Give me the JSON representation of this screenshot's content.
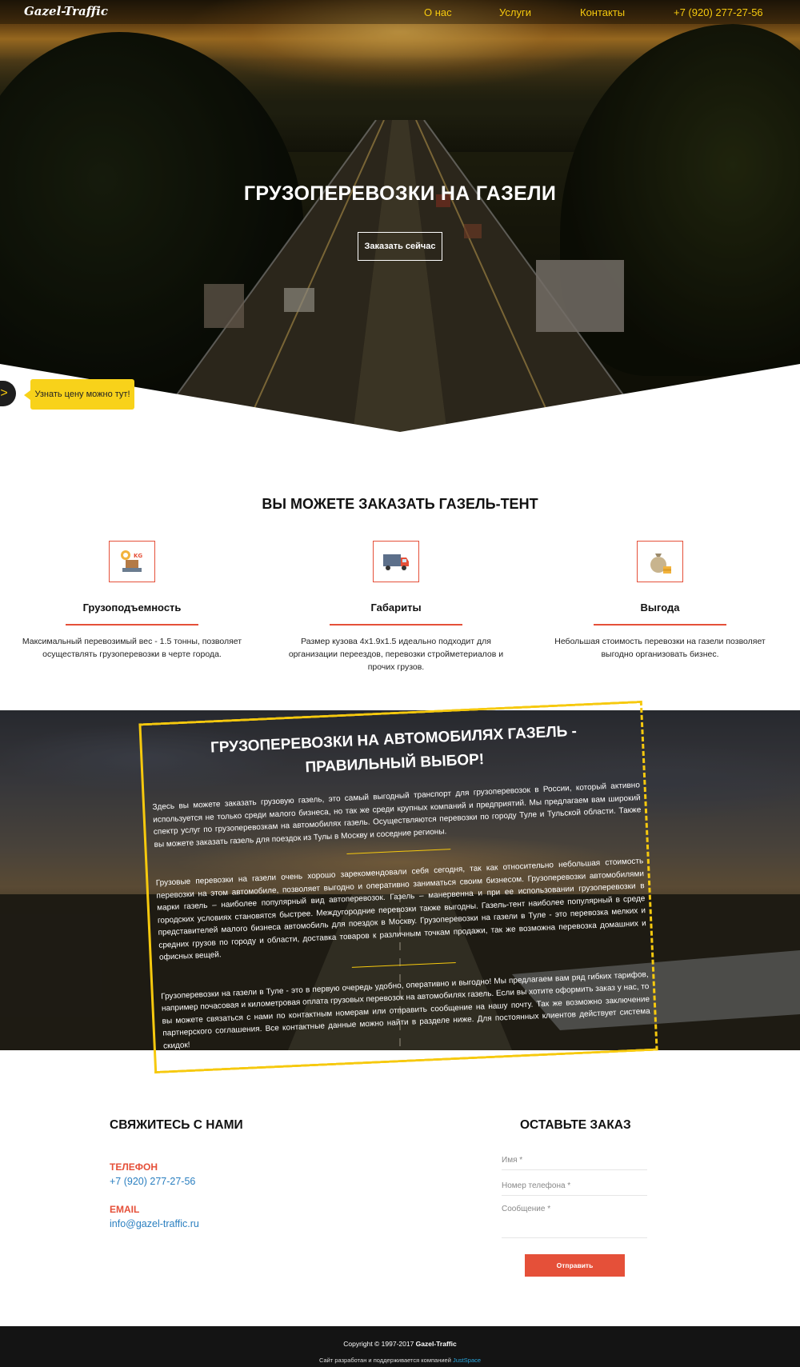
{
  "nav": {
    "logo": "Gazel-Traffic",
    "items": [
      "О нас",
      "Услуги",
      "Контакты"
    ],
    "phone": "+7 (920) 277-27-56"
  },
  "hero": {
    "title": "ГРУЗОПЕРЕВОЗКИ НА ГАЗЕЛИ",
    "button": "Заказать сейчас",
    "price_tip": "Узнать цену можно тут!",
    "arrow_icon": ">"
  },
  "features": {
    "title": "ВЫ МОЖЕТЕ ЗАКАЗАТЬ ГАЗЕЛЬ-ТЕНТ",
    "items": [
      {
        "icon": "scale-weight-icon",
        "name": "Грузоподъемность",
        "text": "Максимальный перевозимый вес - 1.5 тонны, позволяет осуществлять грузоперевозки в черте города."
      },
      {
        "icon": "truck-icon",
        "name": "Габариты",
        "text": "Размер кузова 4х1.9х1.5 идеально подходит для организации переездов, перевозки стройметериалов и прочих грузов."
      },
      {
        "icon": "money-bag-icon",
        "name": "Выгода",
        "text": "Небольшая стоимость перевозки на газели позволяет выгодно организовать бизнес."
      }
    ]
  },
  "about": {
    "title": "ГРУЗОПЕРЕВОЗКИ НА АВТОМОБИЛЯХ ГАЗЕЛЬ - ПРАВИЛЬНЫЙ ВЫБОР!",
    "p1": "Здесь вы можете заказать грузовую газель, это самый выгодный транспорт для грузоперевозок в России, который активно используется не только среди малого бизнеса, но так же среди крупных компаний и предприятий. Мы предлагаем вам широкий спектр услуг по грузоперевозкам на автомобилях газель. Осуществляются перевозки по городу Туле и Тульской области. Также вы можете заказать газель для поездок из Тулы в Москву и соседние регионы.",
    "p2": "Грузовые перевозки на газели очень хорошо зарекомендовали себя сегодня, так как относительно небольшая стоимость перевозки на этом автомобиле, позволяет выгодно и оперативно заниматься своим бизнесом. Грузоперевозки автомобилями марки газель – наиболее популярный вид автоперевозок. Газель – манервенна и при ее использовании грузоперевозки в городских условиях становятся быстрее. Междугородние перевозки также выгодны. Газель-тент наиболее популярный в среде представителей малого бизнеса автомобиль для поездок в Москву. Грузоперевозки на газели в Туле - это перевозка мелких и средних грузов по городу и области, доставка товаров к различным точкам продажи, так же возможна перевозка домашних и офисных вещей.",
    "p3": "Грузоперевозки на газели в Туле - это в первую очередь удобно, оперативно и выгодно! Мы предлагаем вам ряд гибких тарифов, например почасовая и километровая оплата грузовых перевозок на автомобилях газель. Если вы хотите оформить заказ у нас, то вы можете связаться с нами по контактным номерам или отправить сообщение на нашу почту. Так же возможно заключение партнерского соглашения. Все контактные данные можно найти в разделе ниже. Для постоянных клиентов действует система скидок!"
  },
  "contacts": {
    "title": "СВЯЖИТЕСЬ С НАМИ",
    "phone_label": "ТЕЛЕФОН",
    "phone": "+7 (920) 277-27-56",
    "email_label": "EMAIL",
    "email": "info@gazel-traffic.ru"
  },
  "order_form": {
    "title": "ОСТАВЬТЕ ЗАКАЗ",
    "name_placeholder": "Имя *",
    "phone_placeholder": "Номер телефона *",
    "message_placeholder": "Сообщение *",
    "submit": "Отправить"
  },
  "footer": {
    "copyright_prefix": "Copyright © 1997-2017 ",
    "brand": "Gazel-Traffic",
    "made_prefix": "Сайт разработан и поддерживается компанией ",
    "company": "JustSpace"
  }
}
